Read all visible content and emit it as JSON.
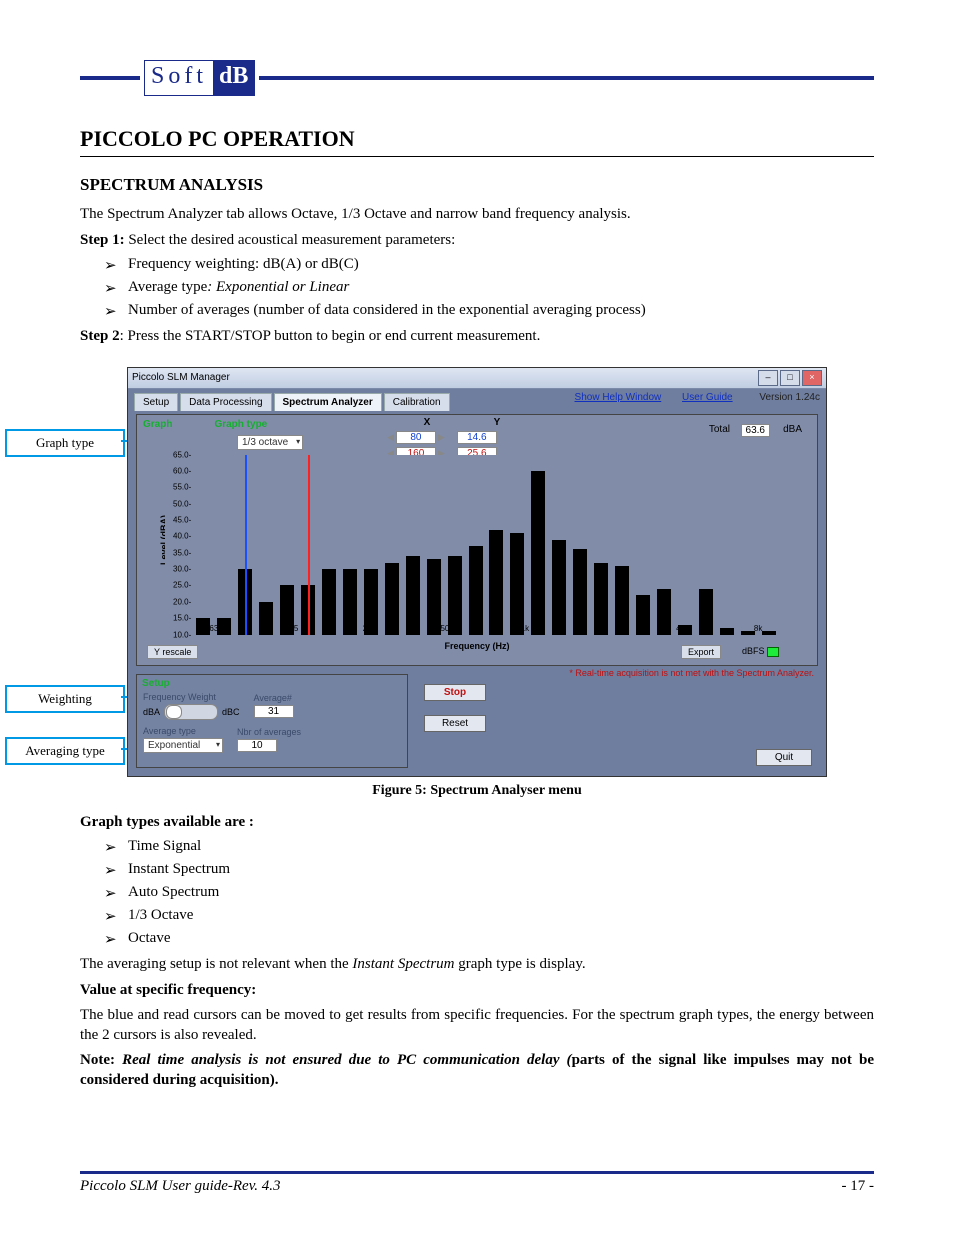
{
  "logo": {
    "soft": "Soft",
    "db": "dB"
  },
  "title": "PICCOLO PC OPERATION",
  "section": "SPECTRUM ANALYSIS",
  "intro": "The Spectrum Analyzer tab allows Octave, 1/3 Octave and narrow band frequency analysis.",
  "step1_label": "Step 1:",
  "step1_text": " Select the desired acoustical measurement parameters:",
  "step1_bullets": [
    "Frequency weighting: dB(A) or dB(C)",
    "Average type",
    "Number of averages (number of data considered in the exponential averaging process)"
  ],
  "step1_bullet2_suffix": ": Exponential or Linear",
  "step2_label": "Step 2",
  "step2_text": ": Press the START/STOP button to begin or end current measurement.",
  "callouts": {
    "graph_type": "Graph type",
    "weighting": "Weighting",
    "averaging": "Averaging type"
  },
  "win": {
    "title": "Piccolo SLM Manager",
    "tabs": [
      "Setup",
      "Data Processing",
      "Spectrum Analyzer",
      "Calibration"
    ],
    "links": {
      "help": "Show Help Window",
      "guide": "User Guide",
      "version": "Version 1.24c"
    },
    "graph_label": "Graph",
    "graph_type_label": "Graph type",
    "graph_type_value": "1/3 octave",
    "X": "X",
    "Y": "Y",
    "x1": "80",
    "y1": "14.6",
    "x2": "160",
    "y2": "25.6",
    "total_label": "Total",
    "total_value": "63.6",
    "total_unit": "dBA",
    "y_ticks": [
      "65.0",
      "60.0",
      "55.0",
      "50.0",
      "45.0",
      "40.0",
      "35.0",
      "30.0",
      "25.0",
      "20.0",
      "15.0",
      "10.0"
    ],
    "x_ticks": [
      "63",
      "125",
      "250",
      "500",
      "1k",
      "2k",
      "4k",
      "8k"
    ],
    "ylabel": "Level (dBA)",
    "xlabel": "Frequency (Hz)",
    "y_rescale": "Y rescale",
    "export": "Export",
    "dbfs": "dBFS",
    "warning": "* Real-time acquisition is not met with the Spectrum Analyzer.",
    "setup_hdr": "Setup",
    "freq_weight_label": "Frequency Weight",
    "dba": "dBA",
    "dbc": "dBC",
    "avg_num_label": "Average#",
    "avg_num_value": "31",
    "avg_type_label": "Average type",
    "avg_type_value": "Exponential",
    "nbr_avg_label": "Nbr of averages",
    "nbr_avg_value": "10",
    "stop": "Stop",
    "reset": "Reset",
    "quit": "Quit"
  },
  "figure_caption": "Figure 5: Spectrum Analyser menu",
  "graph_types_heading": "Graph types available are :",
  "graph_types": [
    "Time Signal",
    "Instant Spectrum",
    "Auto Spectrum",
    "1/3 Octave",
    "Octave"
  ],
  "averaging_note_a": "The averaging setup is not relevant when the ",
  "averaging_note_i": "Instant Spectrum",
  "averaging_note_b": " graph type is display.",
  "value_heading": "Value at specific frequency:",
  "value_text": "The blue and read cursors can be moved to get results from specific frequencies.  For the spectrum graph types, the energy between the 2 cursors is also revealed.",
  "note_label": "Note: ",
  "note_italic": "Real time analysis is not ensured due to PC communication delay (",
  "note_bold_tail": "parts of the signal like impulses may not be considered during acquisition).",
  "footer_doc": "Piccolo SLM User guide-Rev. 4.3",
  "footer_page": "- 17 -",
  "chart_data": {
    "type": "bar",
    "title": "",
    "xlabel": "Frequency (Hz)",
    "ylabel": "Level (dBA)",
    "ylim": [
      10,
      65
    ],
    "x_ticks": [
      "63",
      "125",
      "250",
      "500",
      "1k",
      "2k",
      "4k",
      "8k"
    ],
    "values_dBA": [
      10,
      15,
      15,
      30,
      20,
      25,
      25,
      30,
      30,
      30,
      32,
      34,
      33,
      34,
      37,
      42,
      41,
      60,
      39,
      36,
      32,
      31,
      22,
      24,
      13,
      24,
      12,
      11,
      11,
      10
    ],
    "cursor_blue_hz": 80,
    "cursor_red_hz": 160,
    "cursor_blue_dBA": 14.6,
    "cursor_red_dBA": 25.6,
    "total_dBA": 63.6
  }
}
